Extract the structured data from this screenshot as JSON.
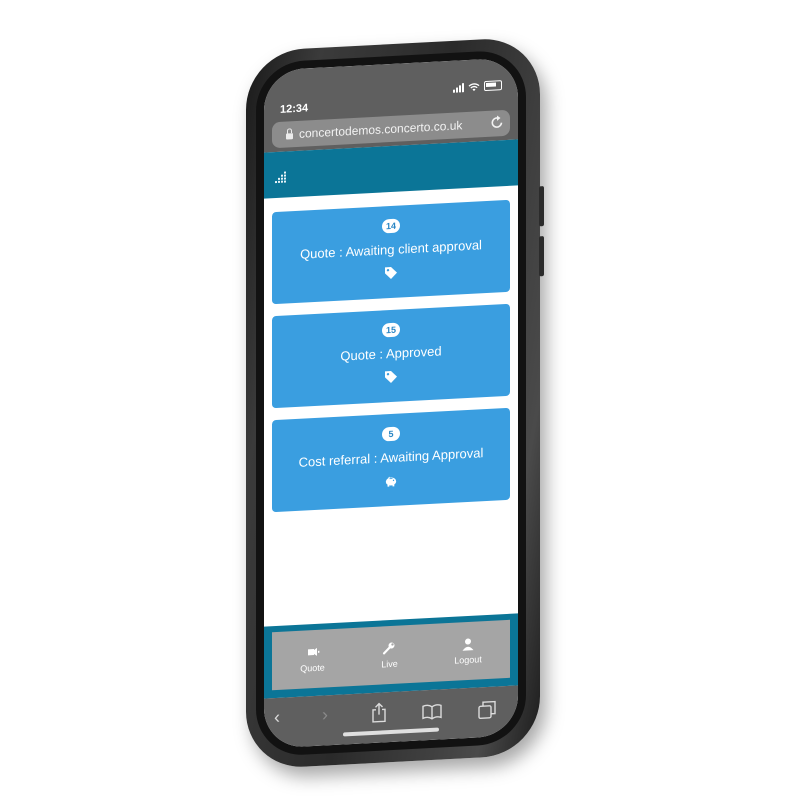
{
  "status_bar": {
    "time": "12:34"
  },
  "browser": {
    "url": "concertodemos.concerto.co.uk",
    "reload_icon": "reload-icon",
    "back_symbol": "‹",
    "forward_symbol": "›",
    "share_symbol": "⇪",
    "bookmarks_symbol": "📖",
    "tabs_symbol": "❐"
  },
  "cards": [
    {
      "count": "14",
      "label": "Quote : Awaiting client approval",
      "icon": "tag-icon"
    },
    {
      "count": "15",
      "label": "Quote : Approved",
      "icon": "tag-icon"
    },
    {
      "count": "5",
      "label": "Cost referral : Awaiting Approval",
      "icon": "piggy-bank-icon"
    }
  ],
  "nav": {
    "quote_label": "Quote",
    "live_label": "Live",
    "logout_label": "Logout"
  },
  "colors": {
    "header_teal": "#0b7597",
    "card_blue": "#3a9ee0",
    "nav_grey": "#a5a5a5",
    "browser_grey": "#5f5f5f"
  }
}
